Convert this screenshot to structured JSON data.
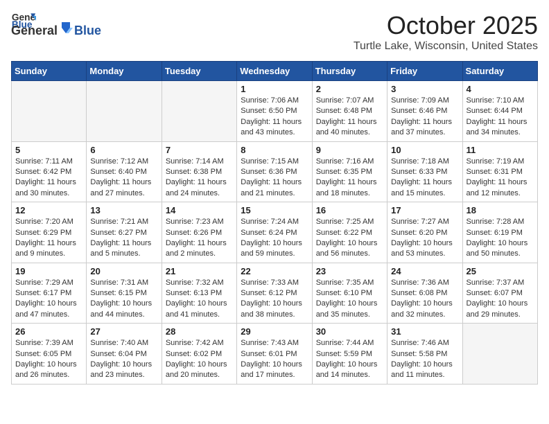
{
  "header": {
    "logo_general": "General",
    "logo_blue": "Blue",
    "month": "October 2025",
    "location": "Turtle Lake, Wisconsin, United States"
  },
  "weekdays": [
    "Sunday",
    "Monday",
    "Tuesday",
    "Wednesday",
    "Thursday",
    "Friday",
    "Saturday"
  ],
  "weeks": [
    [
      {
        "day": "",
        "info": ""
      },
      {
        "day": "",
        "info": ""
      },
      {
        "day": "",
        "info": ""
      },
      {
        "day": "1",
        "info": "Sunrise: 7:06 AM\nSunset: 6:50 PM\nDaylight: 11 hours\nand 43 minutes."
      },
      {
        "day": "2",
        "info": "Sunrise: 7:07 AM\nSunset: 6:48 PM\nDaylight: 11 hours\nand 40 minutes."
      },
      {
        "day": "3",
        "info": "Sunrise: 7:09 AM\nSunset: 6:46 PM\nDaylight: 11 hours\nand 37 minutes."
      },
      {
        "day": "4",
        "info": "Sunrise: 7:10 AM\nSunset: 6:44 PM\nDaylight: 11 hours\nand 34 minutes."
      }
    ],
    [
      {
        "day": "5",
        "info": "Sunrise: 7:11 AM\nSunset: 6:42 PM\nDaylight: 11 hours\nand 30 minutes."
      },
      {
        "day": "6",
        "info": "Sunrise: 7:12 AM\nSunset: 6:40 PM\nDaylight: 11 hours\nand 27 minutes."
      },
      {
        "day": "7",
        "info": "Sunrise: 7:14 AM\nSunset: 6:38 PM\nDaylight: 11 hours\nand 24 minutes."
      },
      {
        "day": "8",
        "info": "Sunrise: 7:15 AM\nSunset: 6:36 PM\nDaylight: 11 hours\nand 21 minutes."
      },
      {
        "day": "9",
        "info": "Sunrise: 7:16 AM\nSunset: 6:35 PM\nDaylight: 11 hours\nand 18 minutes."
      },
      {
        "day": "10",
        "info": "Sunrise: 7:18 AM\nSunset: 6:33 PM\nDaylight: 11 hours\nand 15 minutes."
      },
      {
        "day": "11",
        "info": "Sunrise: 7:19 AM\nSunset: 6:31 PM\nDaylight: 11 hours\nand 12 minutes."
      }
    ],
    [
      {
        "day": "12",
        "info": "Sunrise: 7:20 AM\nSunset: 6:29 PM\nDaylight: 11 hours\nand 9 minutes."
      },
      {
        "day": "13",
        "info": "Sunrise: 7:21 AM\nSunset: 6:27 PM\nDaylight: 11 hours\nand 5 minutes."
      },
      {
        "day": "14",
        "info": "Sunrise: 7:23 AM\nSunset: 6:26 PM\nDaylight: 11 hours\nand 2 minutes."
      },
      {
        "day": "15",
        "info": "Sunrise: 7:24 AM\nSunset: 6:24 PM\nDaylight: 10 hours\nand 59 minutes."
      },
      {
        "day": "16",
        "info": "Sunrise: 7:25 AM\nSunset: 6:22 PM\nDaylight: 10 hours\nand 56 minutes."
      },
      {
        "day": "17",
        "info": "Sunrise: 7:27 AM\nSunset: 6:20 PM\nDaylight: 10 hours\nand 53 minutes."
      },
      {
        "day": "18",
        "info": "Sunrise: 7:28 AM\nSunset: 6:19 PM\nDaylight: 10 hours\nand 50 minutes."
      }
    ],
    [
      {
        "day": "19",
        "info": "Sunrise: 7:29 AM\nSunset: 6:17 PM\nDaylight: 10 hours\nand 47 minutes."
      },
      {
        "day": "20",
        "info": "Sunrise: 7:31 AM\nSunset: 6:15 PM\nDaylight: 10 hours\nand 44 minutes."
      },
      {
        "day": "21",
        "info": "Sunrise: 7:32 AM\nSunset: 6:13 PM\nDaylight: 10 hours\nand 41 minutes."
      },
      {
        "day": "22",
        "info": "Sunrise: 7:33 AM\nSunset: 6:12 PM\nDaylight: 10 hours\nand 38 minutes."
      },
      {
        "day": "23",
        "info": "Sunrise: 7:35 AM\nSunset: 6:10 PM\nDaylight: 10 hours\nand 35 minutes."
      },
      {
        "day": "24",
        "info": "Sunrise: 7:36 AM\nSunset: 6:08 PM\nDaylight: 10 hours\nand 32 minutes."
      },
      {
        "day": "25",
        "info": "Sunrise: 7:37 AM\nSunset: 6:07 PM\nDaylight: 10 hours\nand 29 minutes."
      }
    ],
    [
      {
        "day": "26",
        "info": "Sunrise: 7:39 AM\nSunset: 6:05 PM\nDaylight: 10 hours\nand 26 minutes."
      },
      {
        "day": "27",
        "info": "Sunrise: 7:40 AM\nSunset: 6:04 PM\nDaylight: 10 hours\nand 23 minutes."
      },
      {
        "day": "28",
        "info": "Sunrise: 7:42 AM\nSunset: 6:02 PM\nDaylight: 10 hours\nand 20 minutes."
      },
      {
        "day": "29",
        "info": "Sunrise: 7:43 AM\nSunset: 6:01 PM\nDaylight: 10 hours\nand 17 minutes."
      },
      {
        "day": "30",
        "info": "Sunrise: 7:44 AM\nSunset: 5:59 PM\nDaylight: 10 hours\nand 14 minutes."
      },
      {
        "day": "31",
        "info": "Sunrise: 7:46 AM\nSunset: 5:58 PM\nDaylight: 10 hours\nand 11 minutes."
      },
      {
        "day": "",
        "info": ""
      }
    ]
  ]
}
